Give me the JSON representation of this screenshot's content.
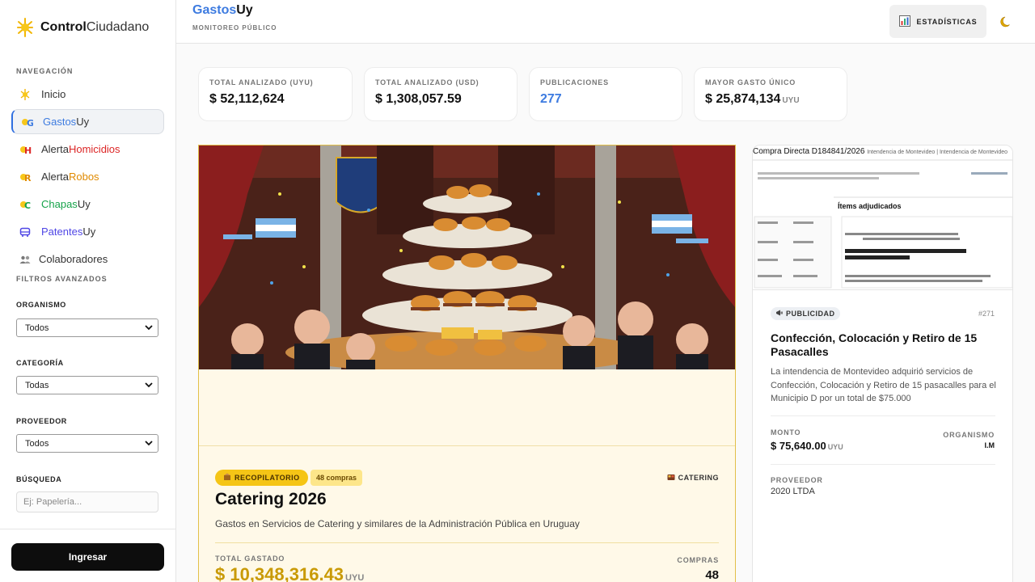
{
  "sidebar": {
    "logo_bold": "Control",
    "logo_light": "Ciudadano",
    "nav_heading": "NAVEGACIÓN",
    "items": [
      {
        "a": "Inicio",
        "b": "",
        "color": "#333333"
      },
      {
        "a": "Gastos",
        "b": "Uy",
        "color": "#3d7be0"
      },
      {
        "a": "Alerta",
        "b": "Homicidios",
        "color": "#dc2626"
      },
      {
        "a": "Alerta",
        "b": "Robos",
        "color": "#e08a00"
      },
      {
        "a": "Chapas",
        "b": "Uy",
        "color": "#16a34a"
      },
      {
        "a": "Patentes",
        "b": "Uy",
        "color": "#4f46e5"
      },
      {
        "a": "Colaboradores",
        "b": "",
        "color": "#333333"
      }
    ],
    "filters_heading": "FILTROS AVANZADOS",
    "filters": {
      "organismo_label": "ORGANISMO",
      "organismo_value": "Todos",
      "categoria_label": "CATEGORÍA",
      "categoria_value": "Todas",
      "proveedor_label": "PROVEEDOR",
      "proveedor_value": "Todos",
      "busqueda_label": "BÚSQUEDA",
      "busqueda_placeholder": "Ej: Papelería..."
    },
    "login_label": "Ingresar"
  },
  "header": {
    "brand_a": "Gastos",
    "brand_b": "Uy",
    "subtitle": "MONITOREO PÚBLICO",
    "stats_label": "ESTADÍSTICAS"
  },
  "stats": [
    {
      "label": "TOTAL ANALIZADO (UYU)",
      "value": "$ 52,112,624",
      "unit": ""
    },
    {
      "label": "TOTAL ANALIZADO (USD)",
      "value": "$ 1,308,057.59",
      "unit": ""
    },
    {
      "label": "PUBLICACIONES",
      "value": "277",
      "unit": ""
    },
    {
      "label": "MAYOR GASTO ÚNICO",
      "value": "$ 25,874,134",
      "unit": "UYU"
    }
  ],
  "featured": {
    "tag": "RECOPILATORIO",
    "count": "48 compras",
    "category": "CATERING",
    "title": "Catering 2026",
    "description": "Gastos en Servicios de Catering y similares de la Administración Pública en Uruguay",
    "total_label": "TOTAL GASTADO",
    "total_value": "$ 10,348,316.43",
    "total_unit": "UYU",
    "purchases_label": "COMPRAS",
    "purchases_value": "48"
  },
  "card": {
    "doc_title": "Compra Directa D184841/2026",
    "doc_org": "Intendencia de Montevideo | Intendencia de Montevideo",
    "doc_items_heading": "Ítems adjudicados",
    "doc_provider": "Proveedor: 2020 LTDA (RUT 040371240017)",
    "tag": "PUBLICIDAD",
    "number": "#271",
    "title": "Confección, Colocación y Retiro de 15 Pasacalles",
    "description": "La intendencia de Montevideo adquirió servicios de Confección, Colocación y Retiro de 15 pasacalles para el Municipio D por un total de $75.000",
    "monto_label": "MONTO",
    "monto_value": "$ 75,640.00",
    "monto_unit": "UYU",
    "org_label": "ORGANISMO",
    "org_value": "I.M",
    "prov_label": "PROVEEDOR",
    "prov_value": "2020 LTDA"
  }
}
